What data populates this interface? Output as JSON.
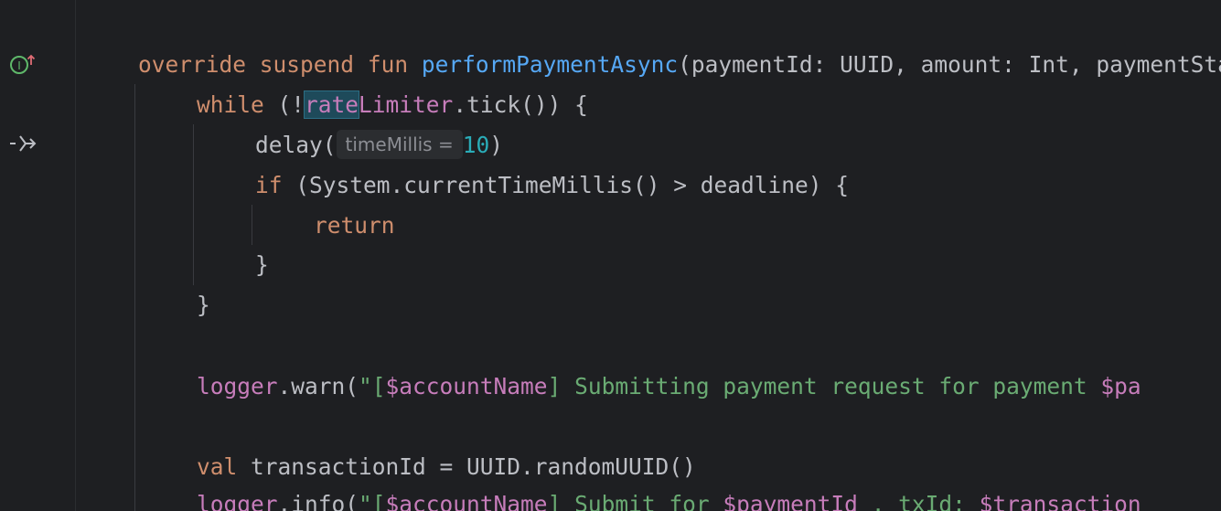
{
  "gutter": {
    "implementing_icon_arrow": "↑",
    "implementing_icon_letter": "I",
    "suspend_call_icon": "-⟩"
  },
  "code": {
    "line1": {
      "kw_override": "override",
      "kw_suspend": "suspend",
      "kw_fun": "fun",
      "fn_name": "performPaymentAsync",
      "params": "(paymentId: UUID, amount: Int, paymentStartedAt: Long, deadline: Long) {"
    },
    "line2": {
      "kw_while": "while",
      "open": " (!",
      "ident_hl": "rate",
      "ident_rest": "Limiter",
      "rest": ".tick()) {"
    },
    "line3": {
      "call": "delay(",
      "inlay": "timeMillis =",
      "num": "10",
      "close": ")"
    },
    "line4": {
      "kw_if": "if",
      "rest": " (System.currentTimeMillis() > deadline) {"
    },
    "line5": {
      "kw_return": "return"
    },
    "line6": {
      "brace": "}"
    },
    "line7": {
      "brace": "}"
    },
    "line9": {
      "logger": "logger",
      "call": ".warn(",
      "str_open": "\"[",
      "interp": "$accountName",
      "str_mid": "] Submitting payment request for payment ",
      "interp2": "$pa"
    },
    "line11": {
      "kw_val": "val",
      "rest": " transactionId = UUID.randomUUID()"
    },
    "line12": {
      "logger": "logger",
      "call": ".info(",
      "str_open": "\"[",
      "interp": "$accountName",
      "str_mid": "] Submit for ",
      "interp2": "$paymentId",
      "str_mid2": " , txId: ",
      "interp3": "$transaction"
    }
  },
  "colors": {
    "background": "#1e1f22",
    "keyword": "#cf8e6d",
    "function": "#56a8f5",
    "string": "#6aab73",
    "interpolation": "#c77dbb",
    "number": "#2aacb8",
    "default": "#bcbec4"
  }
}
